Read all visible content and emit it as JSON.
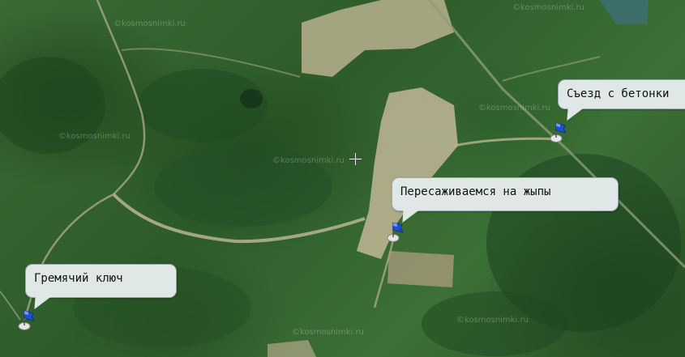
{
  "map": {
    "watermark": "©kosmosnimki.ru"
  },
  "markers": [
    {
      "id": "syezd",
      "label": "Съезд с бетонки"
    },
    {
      "id": "peresazh",
      "label": "Пересаживаемся на жыпы"
    },
    {
      "id": "gremyachiy",
      "label": "Гремячий ключ"
    }
  ]
}
